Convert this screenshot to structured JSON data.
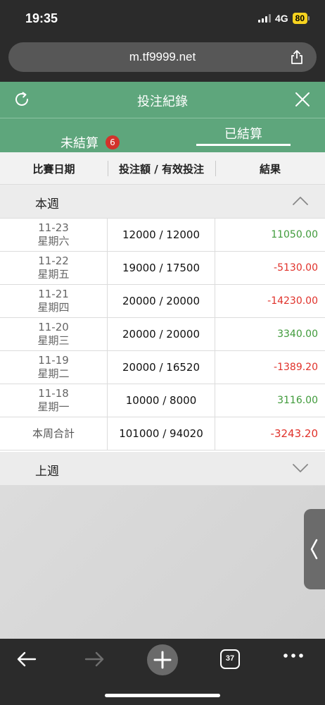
{
  "status_bar": {
    "time": "19:35",
    "network": "4G",
    "battery": "80"
  },
  "browser": {
    "url": "m.tf9999.net"
  },
  "header": {
    "title": "投注紀錄"
  },
  "tabs": [
    {
      "label": "未結算",
      "badge": "6"
    },
    {
      "label": "已結算",
      "active": true
    }
  ],
  "table": {
    "columns": [
      "比賽日期",
      "投注額 / 有效投注",
      "結果"
    ]
  },
  "this_week": {
    "label": "本週",
    "rows": [
      {
        "date": "11-23",
        "weekday": "星期六",
        "amount": "12000 / 12000",
        "result": "11050.00"
      },
      {
        "date": "11-22",
        "weekday": "星期五",
        "amount": "19000 / 17500",
        "result": "-5130.00"
      },
      {
        "date": "11-21",
        "weekday": "星期四",
        "amount": "20000 / 20000",
        "result": "-14230.00"
      },
      {
        "date": "11-20",
        "weekday": "星期三",
        "amount": "20000 / 20000",
        "result": "3340.00"
      },
      {
        "date": "11-19",
        "weekday": "星期二",
        "amount": "20000 / 16520",
        "result": "-1389.20"
      },
      {
        "date": "11-18",
        "weekday": "星期一",
        "amount": "10000 / 8000",
        "result": "3116.00"
      }
    ],
    "total": {
      "label": "本周合計",
      "amount": "101000 / 94020",
      "result": "-3243.20"
    }
  },
  "last_week": {
    "label": "上週"
  },
  "bottom_nav": {
    "tab_count": "37"
  },
  "colors": {
    "green_header": "#5ea67c",
    "positive": "#3f9a3a",
    "negative": "#e0312a",
    "badge": "#d3322b"
  }
}
